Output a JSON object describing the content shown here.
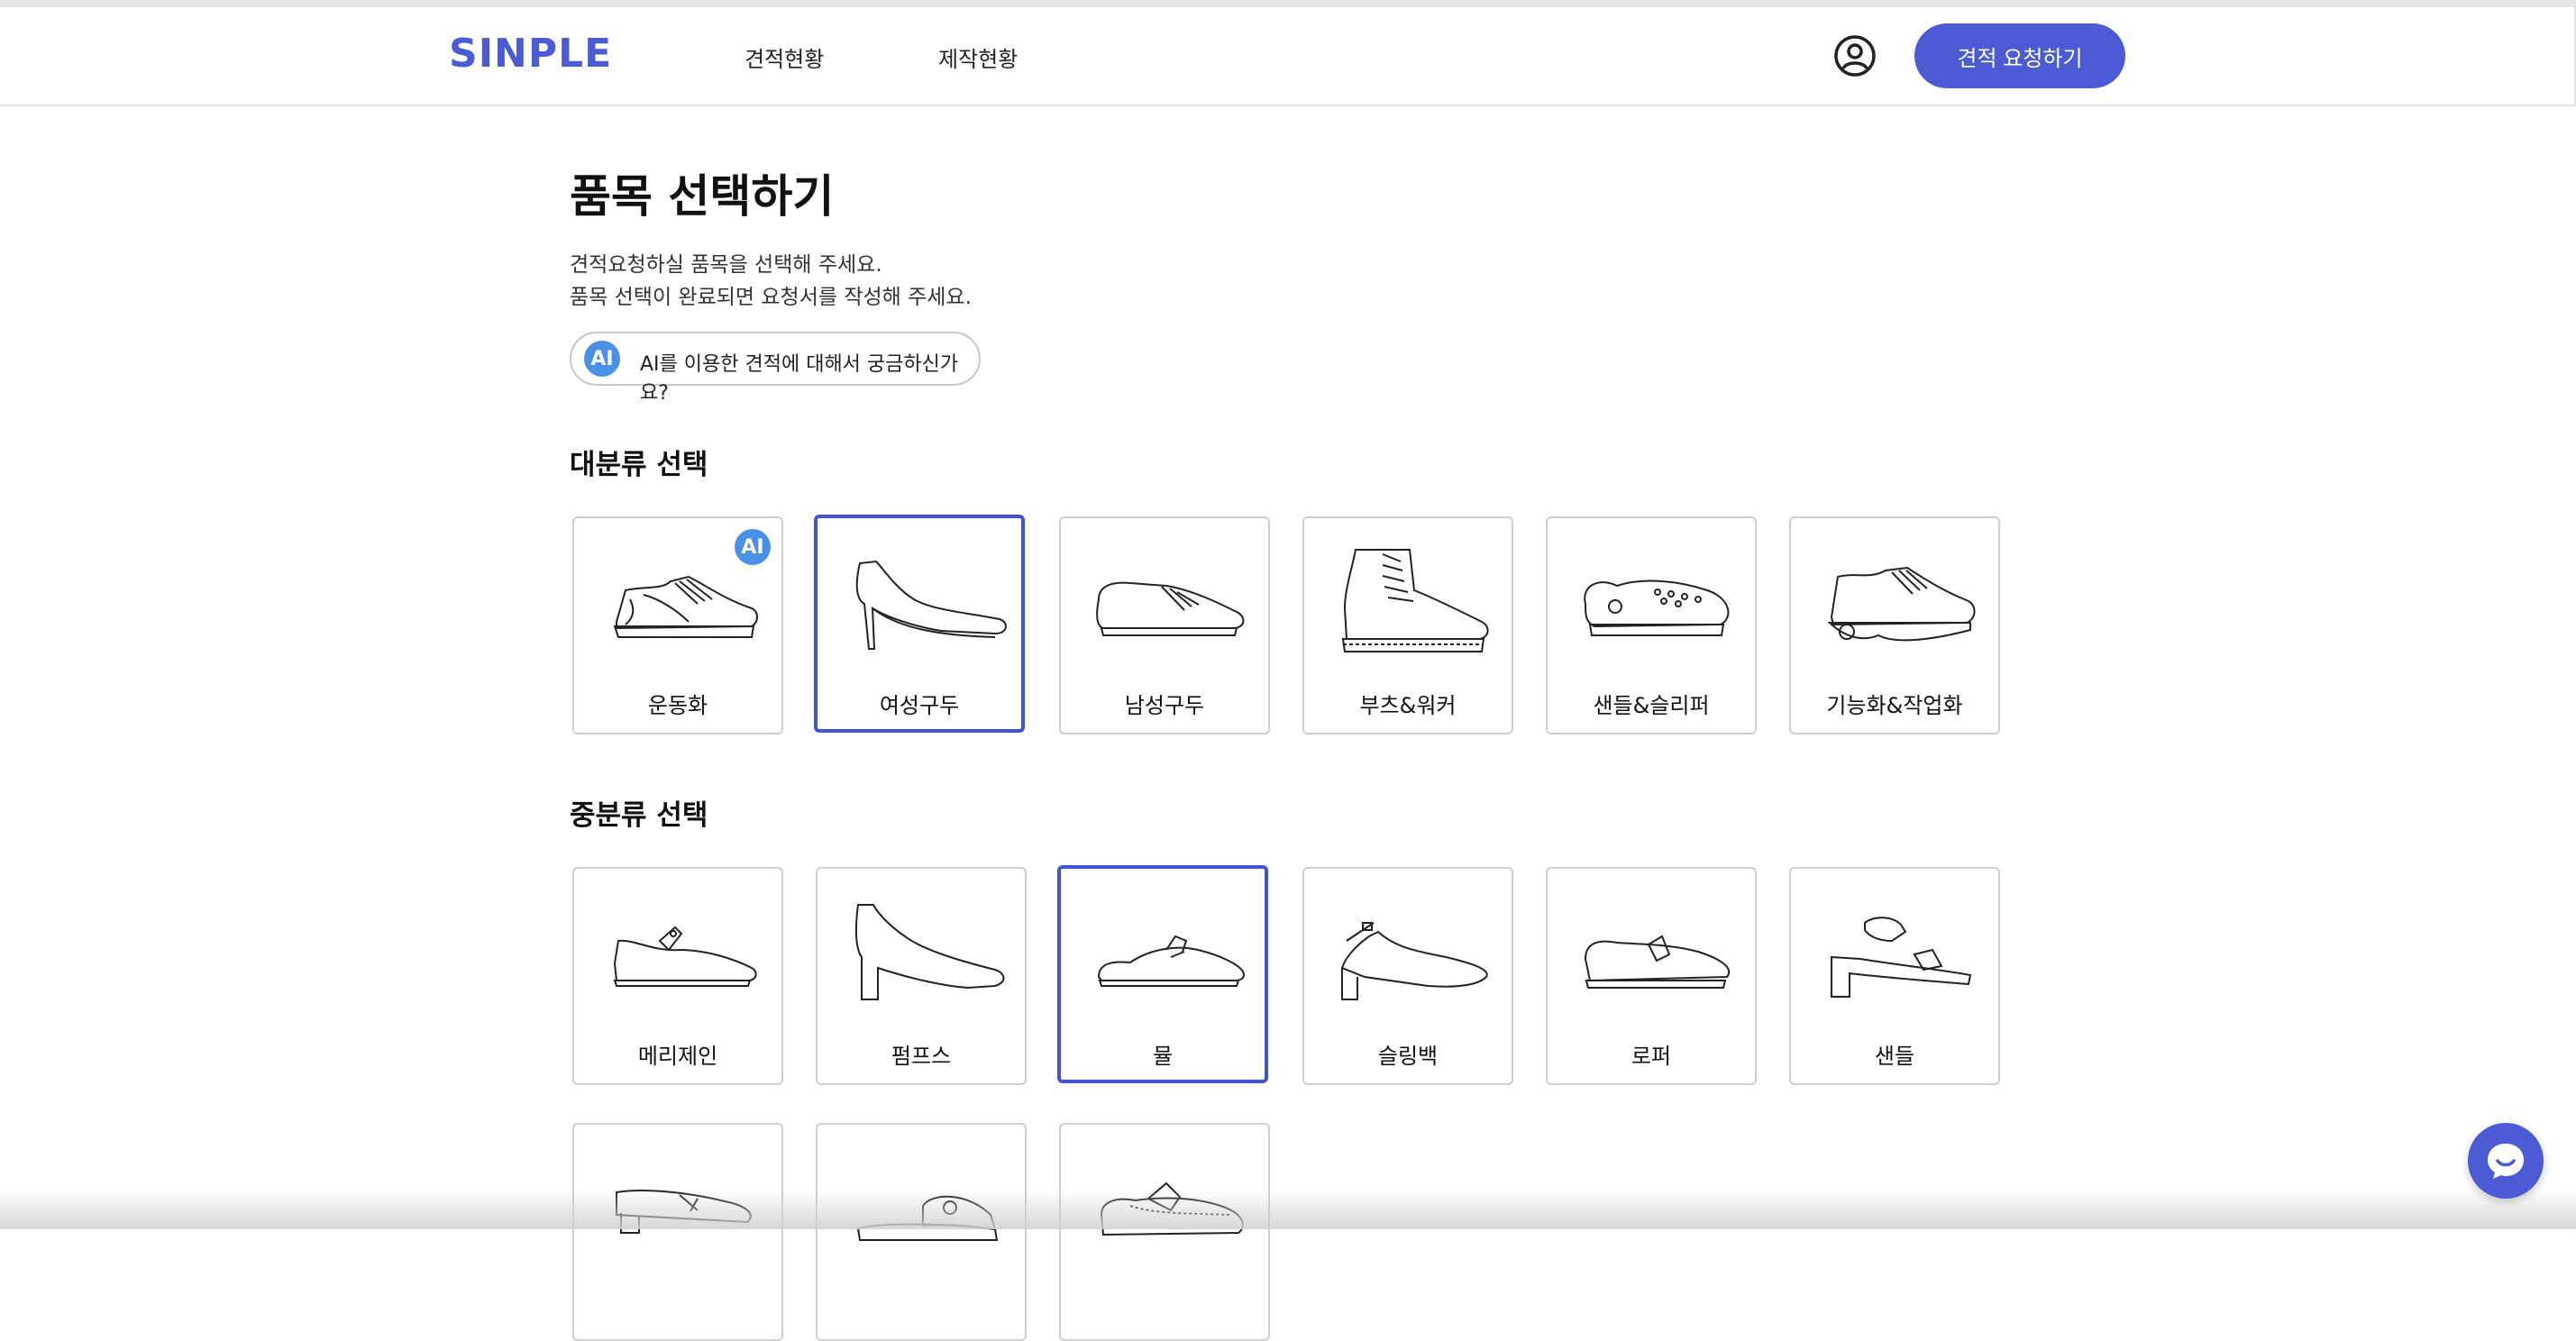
{
  "header": {
    "logo": "SINPLE",
    "nav": [
      "견적현황",
      "제작현황"
    ],
    "user_icon": "user-circle-icon",
    "cta_label": "견적 요청하기"
  },
  "main": {
    "title": "품목 선택하기",
    "description": [
      "견적요청하실 품목을 선택해 주세요.",
      "품목 선택이 완료되면 요청서를 작성해 주세요."
    ],
    "ai_badge": "AI",
    "ai_link": "AI를 이용한 견적에 대해서 궁금하신가요?"
  },
  "major": {
    "title": "대분류 선택",
    "selected": "여성구두",
    "items": [
      {
        "label": "운동화",
        "icon": "sneaker-icon",
        "badge": "AI"
      },
      {
        "label": "여성구두",
        "icon": "high-heel-icon"
      },
      {
        "label": "남성구두",
        "icon": "oxford-shoe-icon"
      },
      {
        "label": "부츠&워커",
        "icon": "boot-icon"
      },
      {
        "label": "샌들&슬리퍼",
        "icon": "clog-icon"
      },
      {
        "label": "기능화&작업화",
        "icon": "running-shoe-icon"
      }
    ]
  },
  "minor": {
    "title": "중분류 선택",
    "selected": "뮬",
    "items": [
      {
        "label": "메리제인",
        "icon": "mary-jane-icon"
      },
      {
        "label": "펌프스",
        "icon": "pumps-icon"
      },
      {
        "label": "뮬",
        "icon": "mule-icon"
      },
      {
        "label": "슬링백",
        "icon": "slingback-icon"
      },
      {
        "label": "로퍼",
        "icon": "loafer-icon"
      },
      {
        "label": "샌들",
        "icon": "sandal-icon"
      },
      {
        "label": "",
        "icon": "thong-sandal-icon"
      },
      {
        "label": "",
        "icon": "slide-icon"
      },
      {
        "label": "",
        "icon": "moccasin-icon"
      }
    ]
  },
  "chat_icon": "chat-bubble-icon",
  "colors": {
    "accent": "#4a5bd4",
    "ai_badge": "#4a8fe8",
    "selected_border": "#3f55d6"
  }
}
